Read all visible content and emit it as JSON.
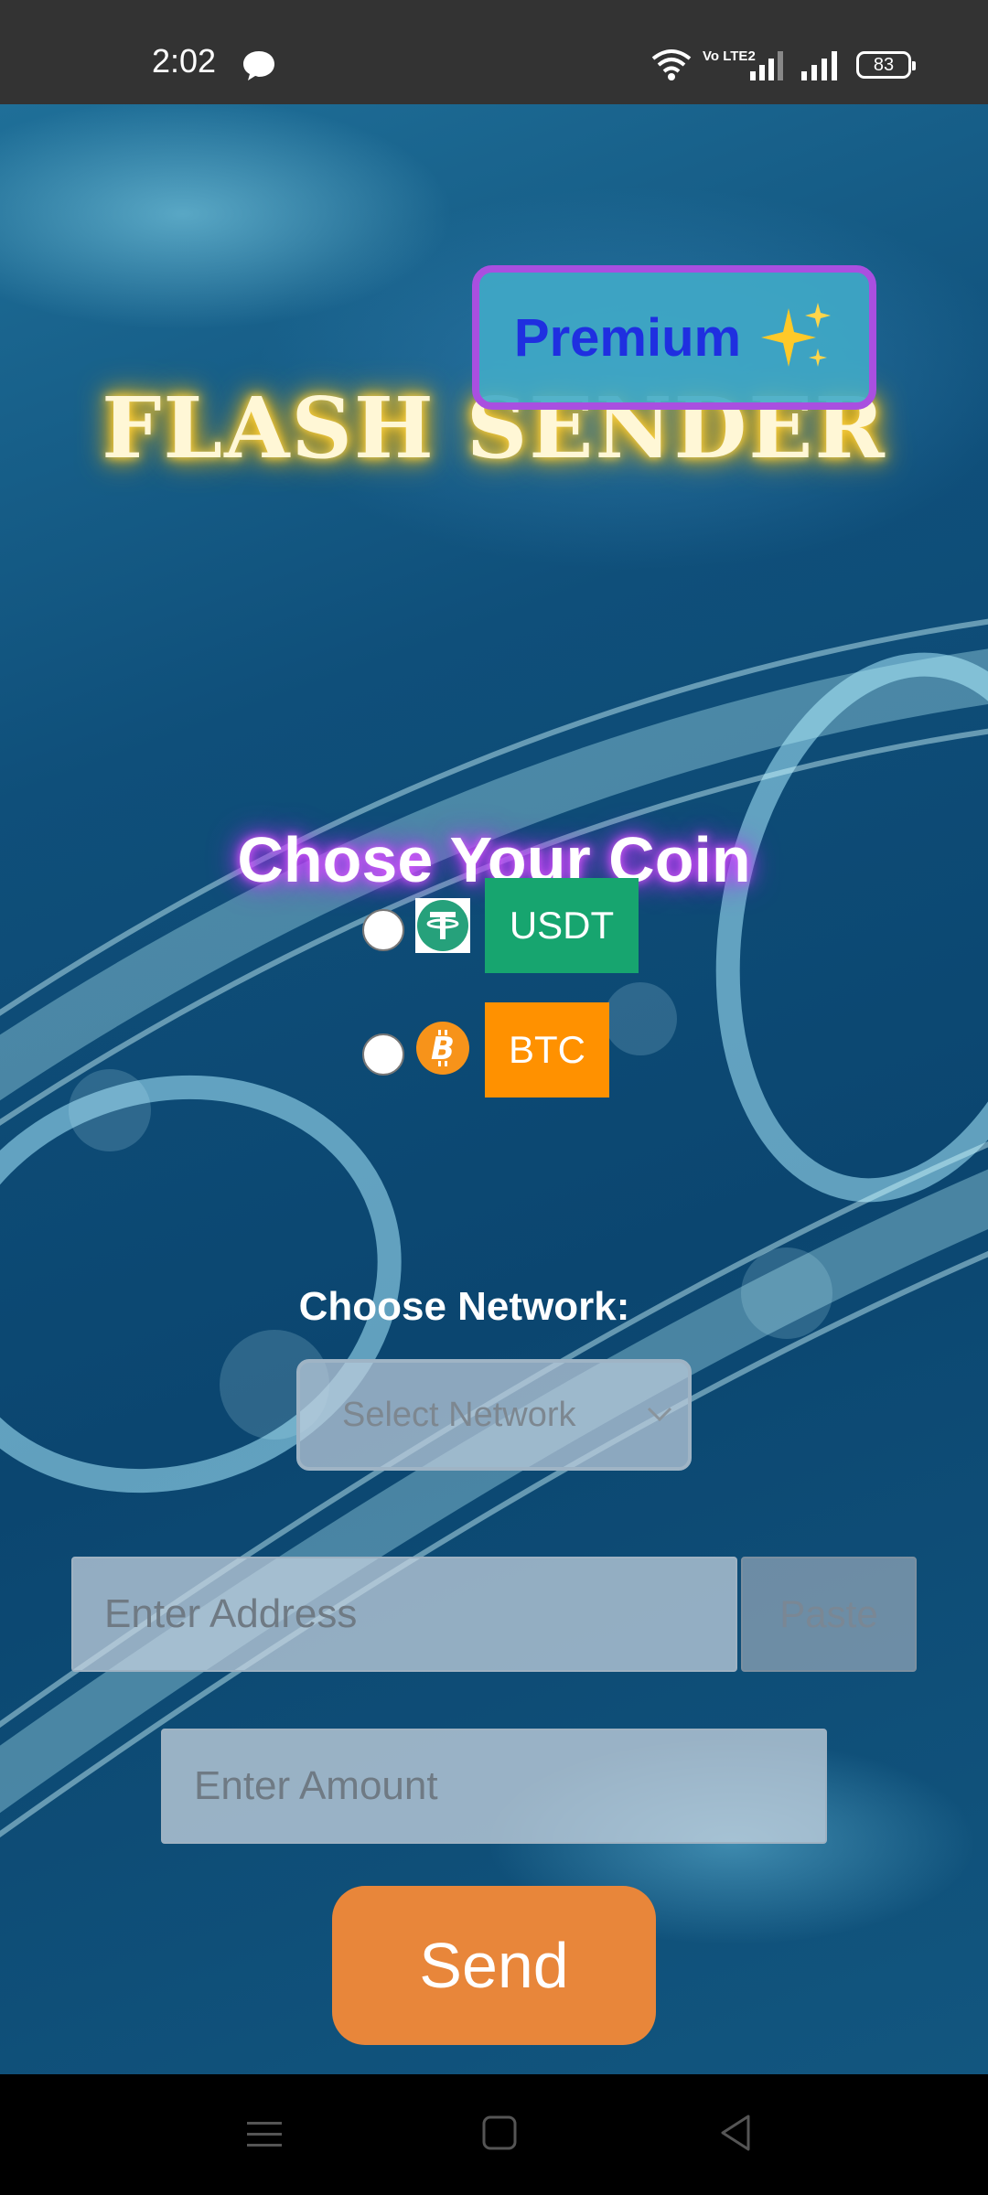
{
  "status_bar": {
    "time": "2:02",
    "volte": "Vo LTE2",
    "battery": "83"
  },
  "app": {
    "title": "FLASH SENDER",
    "premium_label": "Premium",
    "coin_heading": "Chose Your Coin",
    "coins": [
      {
        "label": "USDT",
        "color": "#17a56f",
        "icon": "tether-icon",
        "selected": false
      },
      {
        "label": "BTC",
        "color": "#ff9100",
        "icon": "bitcoin-icon",
        "selected": false
      }
    ],
    "network_heading": "Choose Network:",
    "network_select": "Select Network",
    "address_placeholder": "Enter Address",
    "paste_label": "Paste",
    "amount_placeholder": "Enter Amount",
    "send_label": "Send"
  },
  "colors": {
    "send": "#e8863a",
    "premium_border": "#a94fe0",
    "premium_text": "#1f2fe0"
  },
  "nav": {
    "icons": [
      "menu-icon",
      "home-icon",
      "back-icon"
    ]
  }
}
